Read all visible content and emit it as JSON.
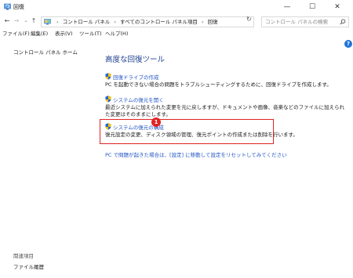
{
  "window": {
    "title": "回復",
    "minimize": "—",
    "maximize": "☐",
    "close": "✕"
  },
  "nav": {
    "back": "←",
    "forward": "→",
    "dropdown": "⌄",
    "up": "↑",
    "breadcrumbs": [
      "コントロール パネル",
      "すべてのコントロール パネル項目",
      "回復"
    ],
    "separator": "›",
    "refresh": "↻",
    "search_placeholder": "コントロール パネルの検索"
  },
  "menubar": {
    "items": [
      "ファイル(F)",
      "編集(E)",
      "表示(V)",
      "ツール(T)",
      "ヘルプ(H)"
    ]
  },
  "sidebar": {
    "home": "コントロール パネル ホーム",
    "related_heading": "関連項目",
    "related_link": "ファイル履歴"
  },
  "main": {
    "heading": "高度な回復ツール",
    "tasks": [
      {
        "link": "回復ドライブの作成",
        "desc": "PC を起動できない場合の問題をトラブルシューティングするために、回復ドライブを作成します。"
      },
      {
        "link": "システムの復元を開く",
        "desc": "最近システムに加えられた変更を元に戻しますが、ドキュメントや画像、音楽などのファイルに加えられた変更はそのままにします。"
      },
      {
        "link": "システムの復元の構成",
        "desc": "復元設定の変更、ディスク領域の管理、復元ポイントの作成または削除を行います。"
      }
    ],
    "pc_reset_link": "PC で問題が起きた場合は、[設定] に移動して設定をリセットしてみてください"
  },
  "annotation": {
    "step_number": "1",
    "color": "#e02424"
  },
  "colors": {
    "link": "#2255c4",
    "heading": "#1e3f8f",
    "help_icon": "#1e73d8"
  },
  "icons": {
    "window": "recovery-icon",
    "address": "control-panel-icon",
    "task": "uac-shield-icon",
    "search": "search-icon",
    "help": "help-icon"
  },
  "help_icon_glyph": "?"
}
